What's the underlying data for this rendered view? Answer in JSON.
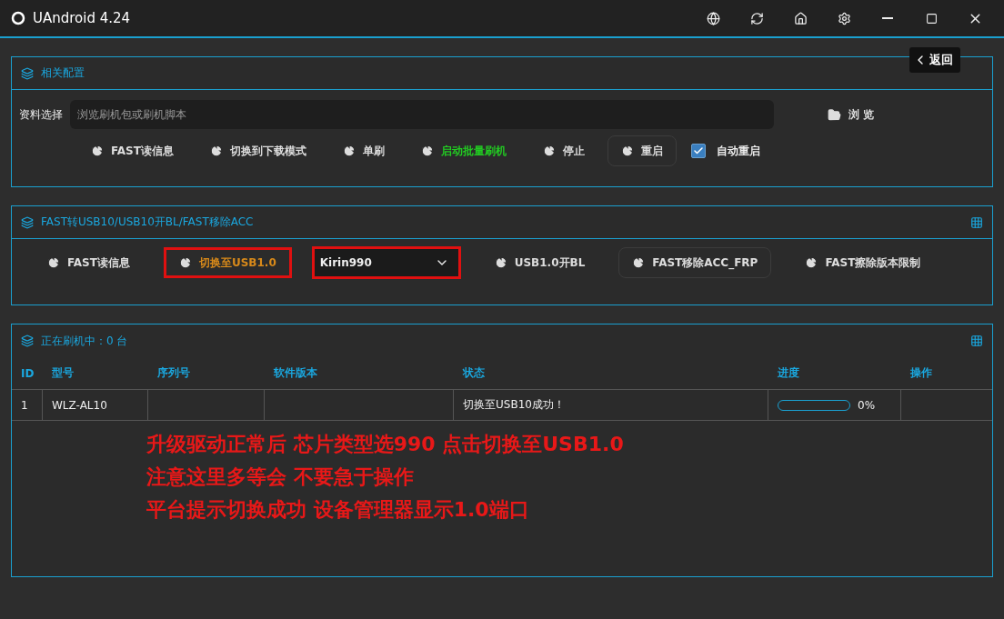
{
  "window": {
    "title": "UAndroid 4.24"
  },
  "back_button": {
    "label": "返回"
  },
  "config_panel": {
    "title": "相关配置",
    "file_label": "资料选择",
    "file_placeholder": "浏览刷机包或刷机脚本",
    "browse_label": "浏 览",
    "buttons": [
      {
        "label": "FAST读信息",
        "kind": "normal",
        "outlined": false
      },
      {
        "label": "切换到下载模式",
        "kind": "normal",
        "outlined": false
      },
      {
        "label": "单刷",
        "kind": "normal",
        "outlined": false
      },
      {
        "label": "启动批量刷机",
        "kind": "success",
        "outlined": false
      },
      {
        "label": "停止",
        "kind": "normal",
        "outlined": false
      },
      {
        "label": "重启",
        "kind": "normal",
        "outlined": true
      }
    ],
    "auto_reboot": {
      "label": "自动重启",
      "checked": true
    }
  },
  "usb_panel": {
    "title": "FAST转USB10/USB10开BL/FAST移除ACC",
    "items": [
      {
        "kind": "button",
        "label": "FAST读信息",
        "outlined": false,
        "annotated": false
      },
      {
        "kind": "warning",
        "label": "切换至USB1.0",
        "outlined": false,
        "annotated": true
      },
      {
        "kind": "select",
        "label": "Kirin990",
        "annotated": true
      },
      {
        "kind": "button",
        "label": "USB1.0开BL",
        "outlined": false,
        "annotated": false
      },
      {
        "kind": "button",
        "label": "FAST移除ACC_FRP",
        "outlined": true,
        "annotated": false
      },
      {
        "kind": "button",
        "label": "FAST擦除版本限制",
        "outlined": false,
        "annotated": false
      }
    ]
  },
  "devices_panel": {
    "title": "正在刷机中：0 台",
    "columns": [
      "ID",
      "型号",
      "序列号",
      "软件版本",
      "状态",
      "进度",
      "操作"
    ],
    "rows": [
      {
        "id": "1",
        "model": "WLZ-AL10",
        "serial": "",
        "version": "",
        "status": "切换至USB10成功！",
        "level": 0,
        "progress": "0%",
        "action": ""
      }
    ]
  },
  "annotations": [
    "升级驱动正常后 芯片类型选990 点击切换至USB1.0",
    "注意这里多等会 不要急于操作",
    "平台提示切换成功 设备管理器显示1.0端口"
  ]
}
